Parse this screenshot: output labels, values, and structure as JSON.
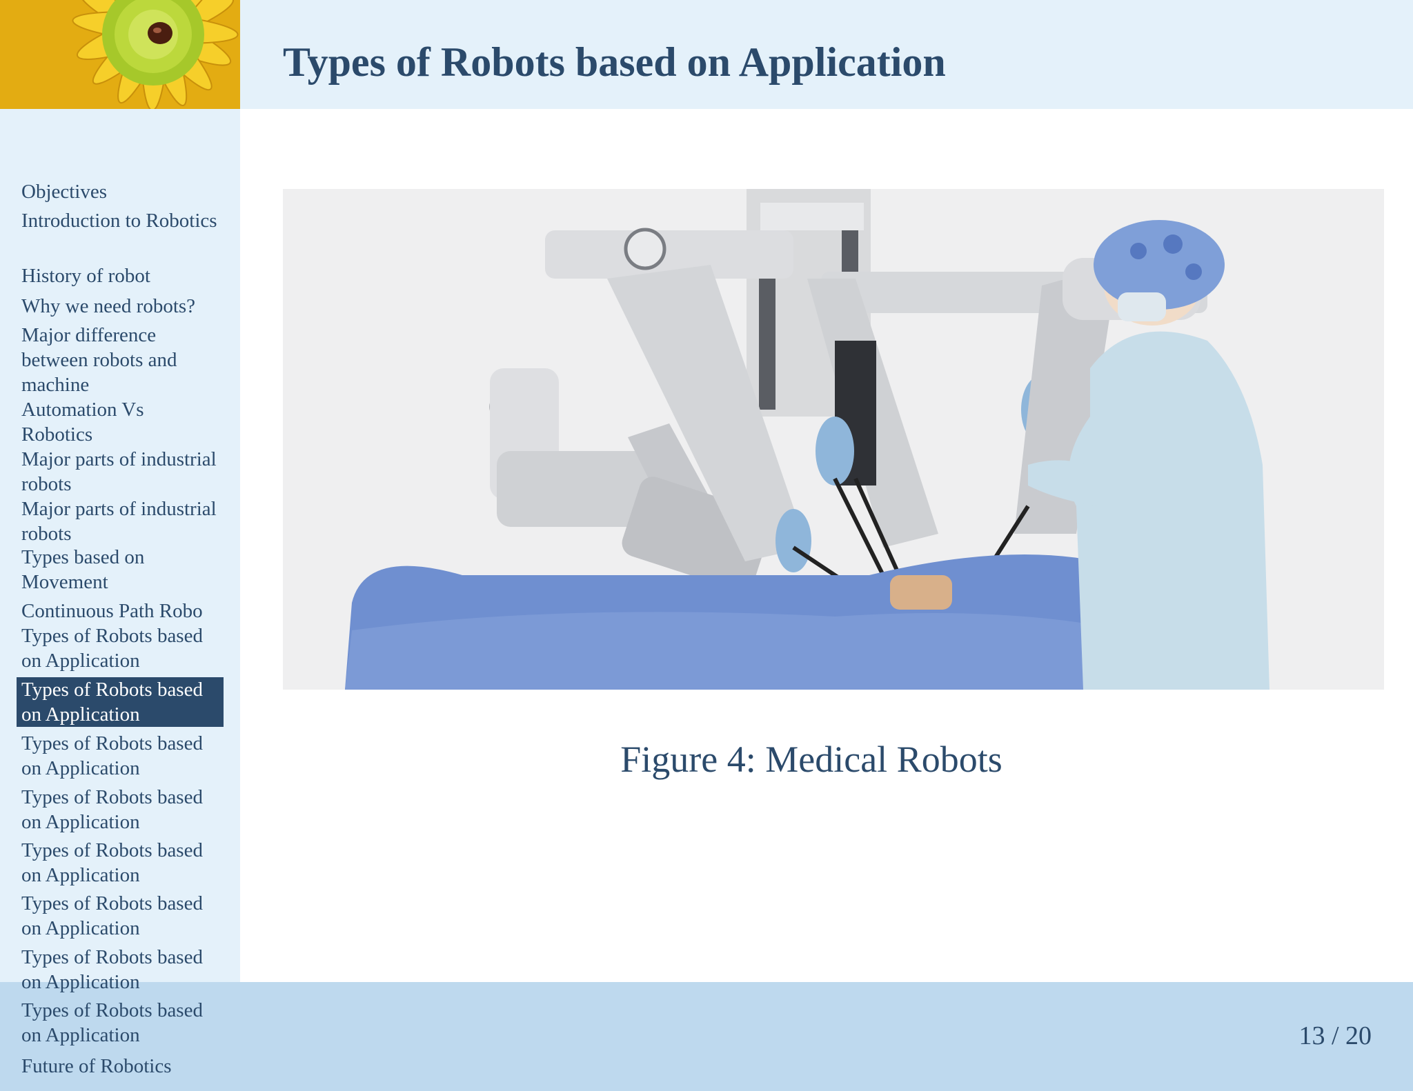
{
  "slide": {
    "title": "Types of Robots based on Application",
    "caption": "Figure 4: Medical Robots",
    "page_number": "13 / 20",
    "figure_subject": "medical-robot-photo"
  },
  "sidebar": {
    "items": [
      {
        "label": "Objectives"
      },
      {
        "label": "Introduction to Robotics"
      },
      {
        "label": "History of robot"
      },
      {
        "label": "Why we need robots?"
      },
      {
        "label": "Major difference between robots and machine"
      },
      {
        "label": "Automation Vs Robotics"
      },
      {
        "label": "Major parts of industrial robots"
      },
      {
        "label": "Major parts of industrial robots"
      },
      {
        "label": "Types based on Movement"
      },
      {
        "label": "Continuous Path Robo"
      },
      {
        "label": "Types of Robots based on Application"
      },
      {
        "label": "Types of Robots based on Application"
      },
      {
        "label": "Types of Robots based on Application"
      },
      {
        "label": "Types of Robots based on Application"
      },
      {
        "label": "Types of Robots based on Application"
      },
      {
        "label": "Types of Robots based on Application"
      },
      {
        "label": "Types of Robots based on Application"
      },
      {
        "label": "Types of Robots based on Application"
      },
      {
        "label": "Future of Robotics"
      }
    ],
    "active_index": 11
  },
  "colors": {
    "header_bg": "#e4f1fa",
    "footer_bg": "#bed9ee",
    "accent": "#2b4a6b"
  }
}
